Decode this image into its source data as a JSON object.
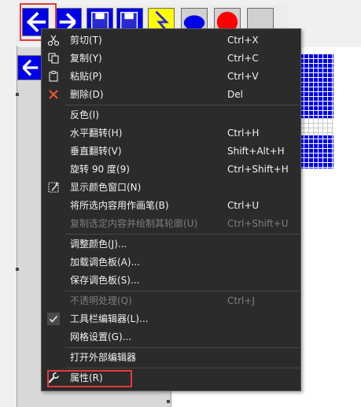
{
  "menu": {
    "items": [
      {
        "label": "剪切(T)",
        "shortcut": "Ctrl+X",
        "icon": "cut-icon"
      },
      {
        "label": "复制(Y)",
        "shortcut": "Ctrl+C",
        "icon": "copy-icon"
      },
      {
        "label": "粘贴(P)",
        "shortcut": "Ctrl+V",
        "icon": "paste-icon"
      },
      {
        "label": "删除(D)",
        "shortcut": "Del",
        "icon": "delete-icon"
      },
      {
        "label": "反色(I)",
        "shortcut": ""
      },
      {
        "label": "水平翻转(H)",
        "shortcut": "Ctrl+H"
      },
      {
        "label": "垂直翻转(V)",
        "shortcut": "Shift+Alt+H"
      },
      {
        "label": "旋转 90 度(9)",
        "shortcut": "Ctrl+Shift+H"
      },
      {
        "label": "显示颜色窗口(N)",
        "shortcut": "",
        "icon": "color-window-icon"
      },
      {
        "label": "将所选内容用作画笔(B)",
        "shortcut": "Ctrl+U"
      },
      {
        "label": "复制选定内容并绘制其轮廓(U)",
        "shortcut": "Ctrl+Shift+U",
        "disabled": true
      },
      {
        "label": "调整颜色(J)...",
        "shortcut": ""
      },
      {
        "label": "加载调色板(A)...",
        "shortcut": ""
      },
      {
        "label": "保存调色板(S)...",
        "shortcut": ""
      },
      {
        "label": "不透明处理(Q)",
        "shortcut": "Ctrl+J",
        "disabled": true
      },
      {
        "label": "工具栏编辑器(L)...",
        "shortcut": "",
        "icon": "checkmark-icon"
      },
      {
        "label": "网格设置(G)...",
        "shortcut": ""
      },
      {
        "label": "打开外部编辑器",
        "shortcut": ""
      },
      {
        "label": "属性(R)",
        "shortcut": "",
        "icon": "wrench-icon"
      }
    ]
  },
  "toolbar": {
    "buttons": [
      "left-arrow-icon",
      "right-arrow-icon",
      "floppy-disk-icon",
      "floppy-disk-icon",
      "lightning-icon",
      "blue-blob-icon",
      "red-circle-icon",
      "blank-icon"
    ]
  },
  "colors": {
    "menu_bg": "#2b2b2b",
    "menu_text": "#f2f2f2",
    "disabled_text": "#7d7d7d",
    "accent_blue": "#0000e8",
    "highlight_red": "#e43a3a"
  }
}
